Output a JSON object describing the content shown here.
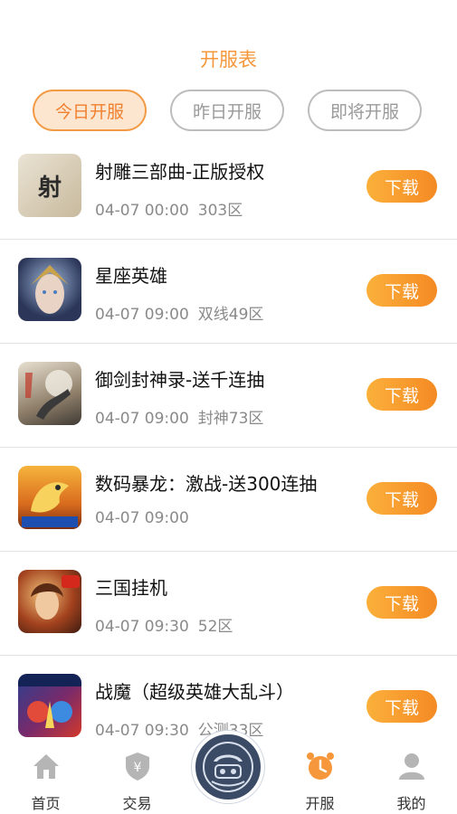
{
  "header": {
    "title": "开服表"
  },
  "tabs": [
    {
      "label": "今日开服",
      "active": true
    },
    {
      "label": "昨日开服",
      "active": false
    },
    {
      "label": "即将开服",
      "active": false
    }
  ],
  "games": [
    {
      "name": "射雕三部曲-正版授权",
      "time": "04-07 00:00",
      "server": "303区",
      "download": "下载",
      "icon": "shediao-icon"
    },
    {
      "name": "星座英雄",
      "time": "04-07 09:00",
      "server": "双线49区",
      "download": "下载",
      "icon": "xingzuo-icon"
    },
    {
      "name": "御剑封神录-送千连抽",
      "time": "04-07 09:00",
      "server": "封神73区",
      "download": "下载",
      "icon": "yujian-icon"
    },
    {
      "name": "数码暴龙：激战-送300连抽",
      "time": "04-07 09:00",
      "server": "",
      "download": "下载",
      "icon": "shuma-icon"
    },
    {
      "name": "三国挂机",
      "time": "04-07 09:30",
      "server": "52区",
      "download": "下载",
      "icon": "sanguo-icon"
    },
    {
      "name": "战魔（超级英雄大乱斗）",
      "time": "04-07 09:30",
      "server": "公测33区",
      "download": "下载",
      "icon": "zhanmo-icon"
    }
  ],
  "nav": [
    {
      "label": "首页",
      "icon": "home-icon",
      "active": false
    },
    {
      "label": "交易",
      "icon": "shield-yen-icon",
      "active": false
    },
    {
      "label": "",
      "icon": "center-logo-icon",
      "active": false
    },
    {
      "label": "开服",
      "icon": "alarm-clock-icon",
      "active": true
    },
    {
      "label": "我的",
      "icon": "user-icon",
      "active": false
    }
  ],
  "colors": {
    "accent": "#f5973a",
    "tab_active_bg": "#fde6cf",
    "button": "#f48a24",
    "nav_inactive": "#b5b5b5"
  }
}
